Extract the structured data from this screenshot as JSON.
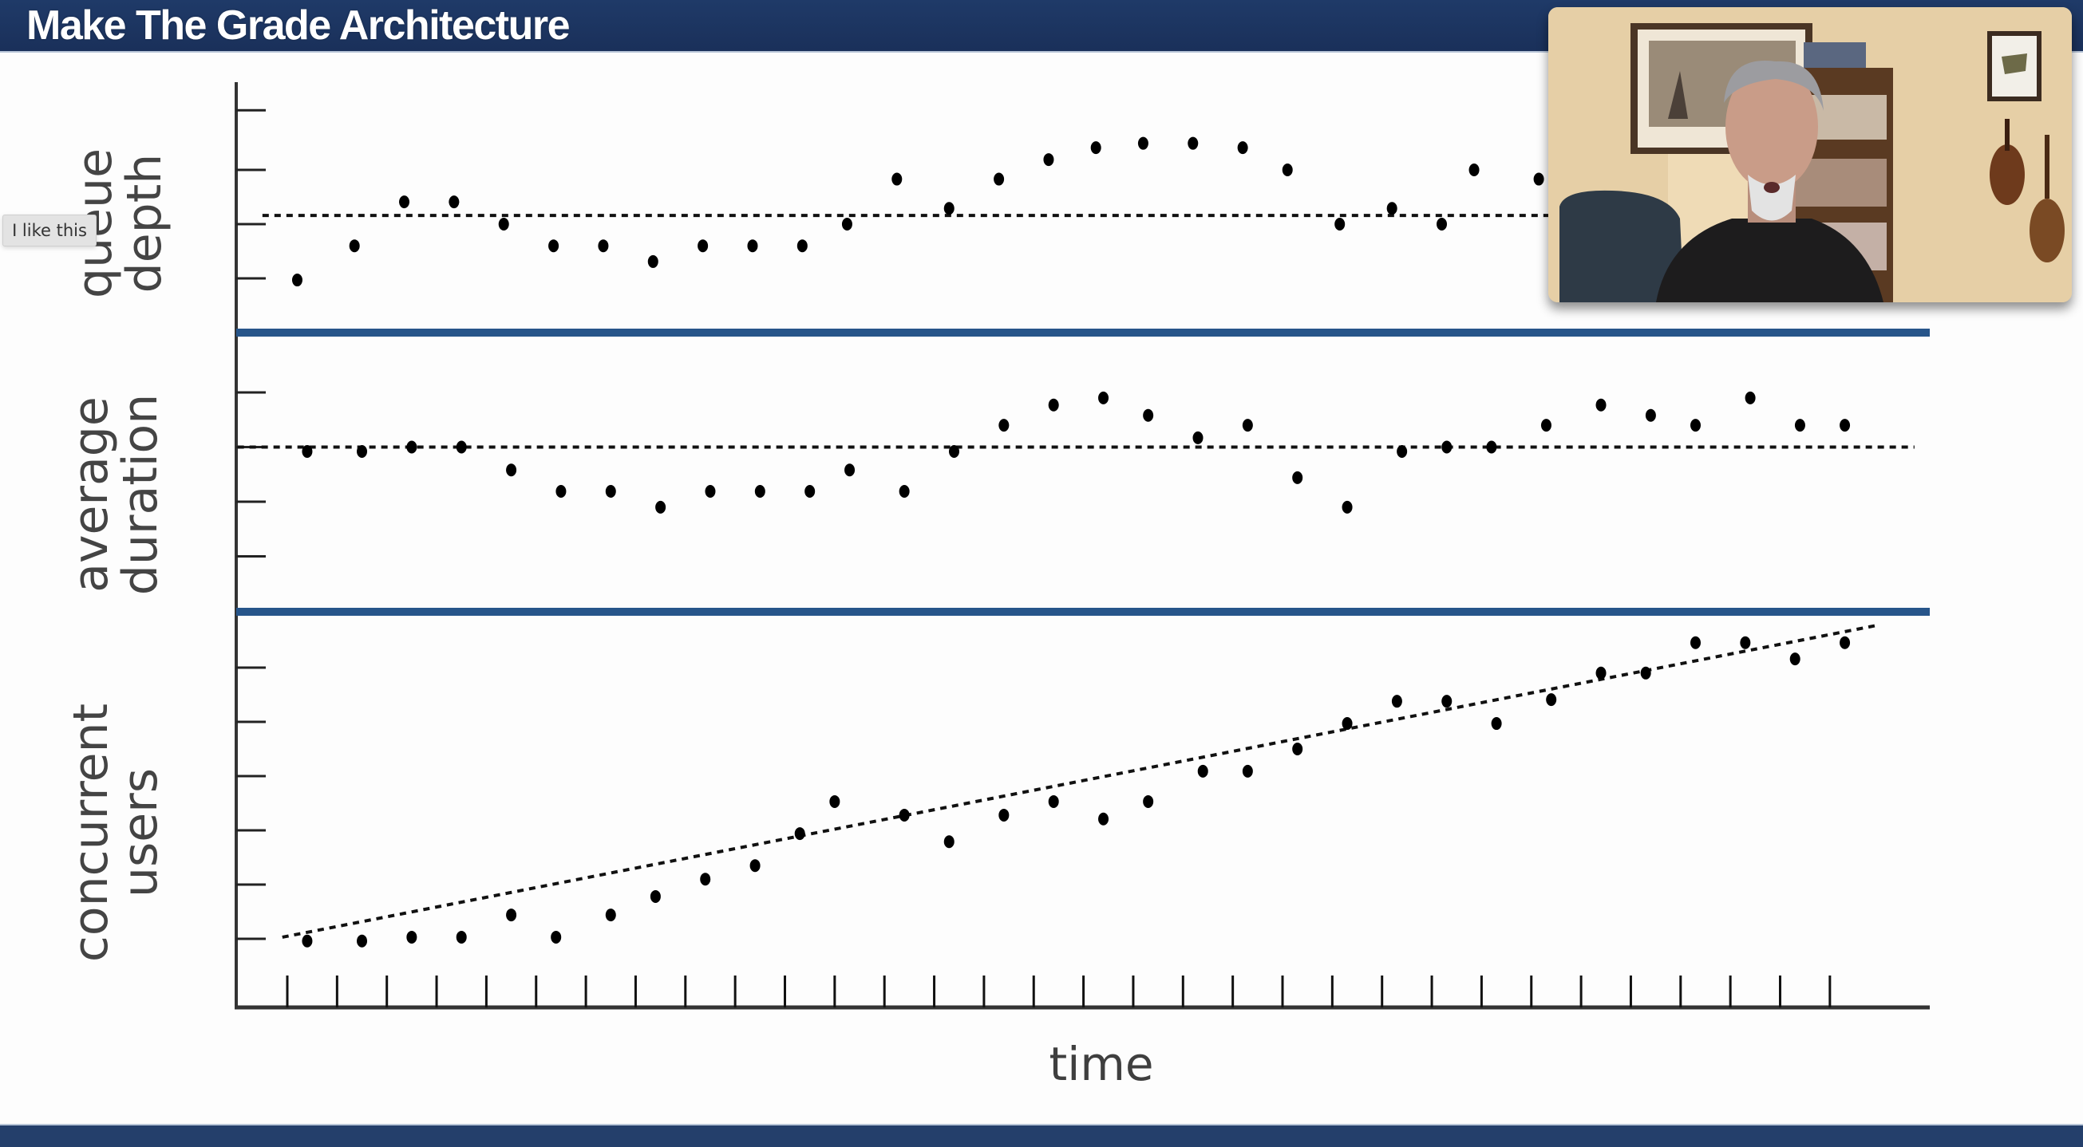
{
  "header": {
    "title": "Make The Grade Architecture"
  },
  "overlay": {
    "like_button_label": "I like this",
    "webcam": "presenter-video-feed"
  },
  "colors": {
    "title_bar": "#1c3461",
    "bottom_bar": "#243f6b",
    "panel_divider": "#27558a",
    "axis": "#333333",
    "points": "#000000",
    "label_text": "#444444"
  },
  "chart_data": {
    "type": "scatter",
    "title": "",
    "xlabel": "time",
    "x_ticks_count": 32,
    "xlim": [
      -1.0,
      33.0
    ],
    "panels": [
      {
        "name": "queue depth",
        "ylabel_lines": [
          "queue",
          "depth"
        ],
        "ylim": [
          0,
          4.6
        ],
        "y_ticks": [
          1,
          2,
          3,
          4.1
        ],
        "reference_line": {
          "kind": "mean",
          "style": "dashed",
          "y": 2.16,
          "x_range": [
            -0.5,
            25.4
          ]
        },
        "points": [
          {
            "x": 0.2,
            "y": 0.97
          },
          {
            "x": 1.35,
            "y": 1.6
          },
          {
            "x": 2.35,
            "y": 2.41
          },
          {
            "x": 3.35,
            "y": 2.41
          },
          {
            "x": 4.35,
            "y": 2.0
          },
          {
            "x": 5.35,
            "y": 1.6
          },
          {
            "x": 6.35,
            "y": 1.6
          },
          {
            "x": 7.35,
            "y": 1.31
          },
          {
            "x": 8.35,
            "y": 1.6
          },
          {
            "x": 9.35,
            "y": 1.6
          },
          {
            "x": 10.35,
            "y": 1.6
          },
          {
            "x": 11.25,
            "y": 2.0
          },
          {
            "x": 12.25,
            "y": 2.83
          },
          {
            "x": 13.3,
            "y": 2.29
          },
          {
            "x": 14.3,
            "y": 2.83
          },
          {
            "x": 15.3,
            "y": 3.19
          },
          {
            "x": 16.25,
            "y": 3.41
          },
          {
            "x": 17.2,
            "y": 3.49
          },
          {
            "x": 18.2,
            "y": 3.49
          },
          {
            "x": 19.2,
            "y": 3.41
          },
          {
            "x": 20.1,
            "y": 3.0
          },
          {
            "x": 21.15,
            "y": 2.0
          },
          {
            "x": 22.2,
            "y": 2.29
          },
          {
            "x": 23.2,
            "y": 2.0
          },
          {
            "x": 23.85,
            "y": 3.0
          },
          {
            "x": 25.15,
            "y": 2.83
          }
        ]
      },
      {
        "name": "average duration",
        "ylabel_lines": [
          "average",
          "duration"
        ],
        "ylim": [
          0,
          5.1
        ],
        "y_ticks": [
          1,
          2,
          3,
          4
        ],
        "reference_line": {
          "kind": "mean",
          "style": "dashed",
          "y": 3.0,
          "x_range": [
            -1.0,
            32.7
          ]
        },
        "points": [
          {
            "x": 0.4,
            "y": 2.92
          },
          {
            "x": 1.5,
            "y": 2.92
          },
          {
            "x": 2.5,
            "y": 3.0
          },
          {
            "x": 3.5,
            "y": 3.0
          },
          {
            "x": 4.5,
            "y": 2.58
          },
          {
            "x": 5.5,
            "y": 2.19
          },
          {
            "x": 6.5,
            "y": 2.19
          },
          {
            "x": 7.5,
            "y": 1.9
          },
          {
            "x": 8.5,
            "y": 2.19
          },
          {
            "x": 9.5,
            "y": 2.19
          },
          {
            "x": 10.5,
            "y": 2.19
          },
          {
            "x": 11.3,
            "y": 2.58
          },
          {
            "x": 12.4,
            "y": 2.19
          },
          {
            "x": 13.4,
            "y": 2.92
          },
          {
            "x": 14.4,
            "y": 3.4
          },
          {
            "x": 15.4,
            "y": 3.77
          },
          {
            "x": 16.4,
            "y": 3.9
          },
          {
            "x": 17.3,
            "y": 3.58
          },
          {
            "x": 18.3,
            "y": 3.17
          },
          {
            "x": 19.3,
            "y": 3.4
          },
          {
            "x": 20.3,
            "y": 2.44
          },
          {
            "x": 21.3,
            "y": 1.9
          },
          {
            "x": 22.4,
            "y": 2.92
          },
          {
            "x": 23.3,
            "y": 3.0
          },
          {
            "x": 24.2,
            "y": 3.0
          },
          {
            "x": 25.3,
            "y": 3.4
          },
          {
            "x": 26.4,
            "y": 3.77
          },
          {
            "x": 27.4,
            "y": 3.58
          },
          {
            "x": 28.3,
            "y": 3.4
          },
          {
            "x": 29.4,
            "y": 3.9
          },
          {
            "x": 30.4,
            "y": 3.4
          },
          {
            "x": 31.3,
            "y": 3.4
          }
        ]
      },
      {
        "name": "concurrent users",
        "ylabel_lines": [
          "concurrent",
          "users"
        ],
        "ylim": [
          -0.26,
          7.0
        ],
        "y_ticks": [
          1,
          2,
          3,
          4,
          5,
          6
        ],
        "reference_line": {
          "kind": "trend",
          "style": "dashed",
          "from": {
            "x": -0.1,
            "y": 1.03
          },
          "to": {
            "x": 31.95,
            "y": 6.78
          }
        },
        "points": [
          {
            "x": 0.4,
            "y": 0.96
          },
          {
            "x": 1.5,
            "y": 0.96
          },
          {
            "x": 2.5,
            "y": 1.03
          },
          {
            "x": 3.5,
            "y": 1.03
          },
          {
            "x": 4.5,
            "y": 1.44
          },
          {
            "x": 5.4,
            "y": 1.03
          },
          {
            "x": 6.5,
            "y": 1.44
          },
          {
            "x": 7.4,
            "y": 1.78
          },
          {
            "x": 8.4,
            "y": 2.1
          },
          {
            "x": 9.4,
            "y": 2.35
          },
          {
            "x": 10.3,
            "y": 2.94
          },
          {
            "x": 11.0,
            "y": 3.53
          },
          {
            "x": 12.4,
            "y": 3.28
          },
          {
            "x": 13.3,
            "y": 2.79
          },
          {
            "x": 14.4,
            "y": 3.28
          },
          {
            "x": 15.4,
            "y": 3.53
          },
          {
            "x": 16.4,
            "y": 3.21
          },
          {
            "x": 17.3,
            "y": 3.53
          },
          {
            "x": 18.4,
            "y": 4.09
          },
          {
            "x": 19.3,
            "y": 4.09
          },
          {
            "x": 20.3,
            "y": 4.5
          },
          {
            "x": 21.3,
            "y": 4.97
          },
          {
            "x": 22.3,
            "y": 5.38
          },
          {
            "x": 23.3,
            "y": 5.38
          },
          {
            "x": 24.3,
            "y": 4.97
          },
          {
            "x": 25.4,
            "y": 5.41
          },
          {
            "x": 26.4,
            "y": 5.9
          },
          {
            "x": 27.3,
            "y": 5.9
          },
          {
            "x": 28.3,
            "y": 6.46
          },
          {
            "x": 29.3,
            "y": 6.46
          },
          {
            "x": 30.3,
            "y": 6.16
          },
          {
            "x": 31.3,
            "y": 6.46
          }
        ]
      }
    ],
    "grid": false,
    "legend": "none"
  }
}
